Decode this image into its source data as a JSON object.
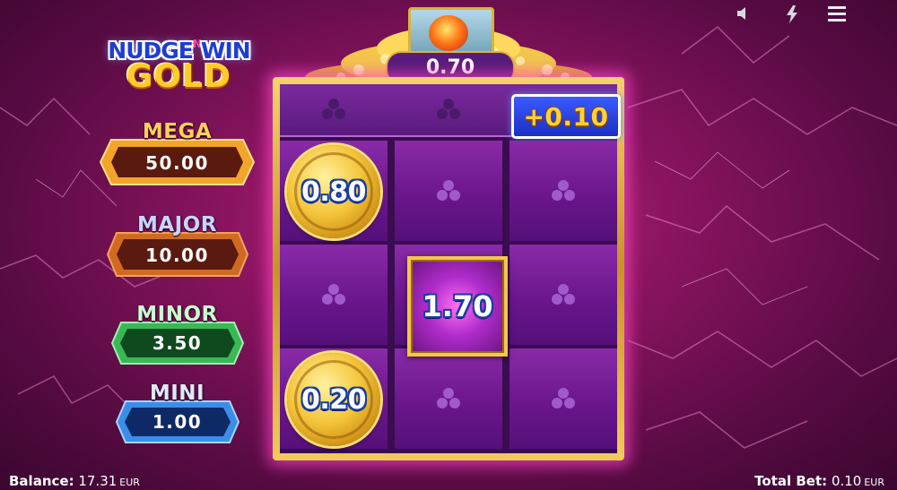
{
  "logo": {
    "line1_a": "NUDGE",
    "line1_n": "N",
    "line1_b": "WIN",
    "line2": "GOLD"
  },
  "jackpots": [
    {
      "name": "MEGA",
      "value": "50.00",
      "title_color": "#ffd15a",
      "box_color": "#f2a52a",
      "fill_color": "#5a1a0e"
    },
    {
      "name": "MAJOR",
      "value": "10.00",
      "title_color": "#c8d4ff",
      "box_color": "#d06a22",
      "fill_color": "#5a1a10"
    },
    {
      "name": "MINOR",
      "value": "3.50",
      "title_color": "#c9ffd0",
      "box_color": "#3ab857",
      "fill_color": "#0e4a1e"
    },
    {
      "name": "MINI",
      "value": "1.00",
      "title_color": "#dfe9ff",
      "box_color": "#3a8ee8",
      "fill_color": "#0e2a66"
    }
  ],
  "pot": {
    "value": "0.70"
  },
  "bonus": {
    "value": "+0.10"
  },
  "coins": [
    {
      "value": "0.80"
    },
    {
      "value": "0.20"
    }
  ],
  "special": {
    "value": "1.70"
  },
  "footer": {
    "balance_label": "Balance:",
    "balance_value": "17.31",
    "balance_currency": "EUR",
    "bet_label": "Total Bet:",
    "bet_value": "0.10",
    "bet_currency": "EUR"
  },
  "icons": [
    "speaker-icon",
    "lightning-icon",
    "menu-icon",
    "cluster-symbol-icon"
  ]
}
